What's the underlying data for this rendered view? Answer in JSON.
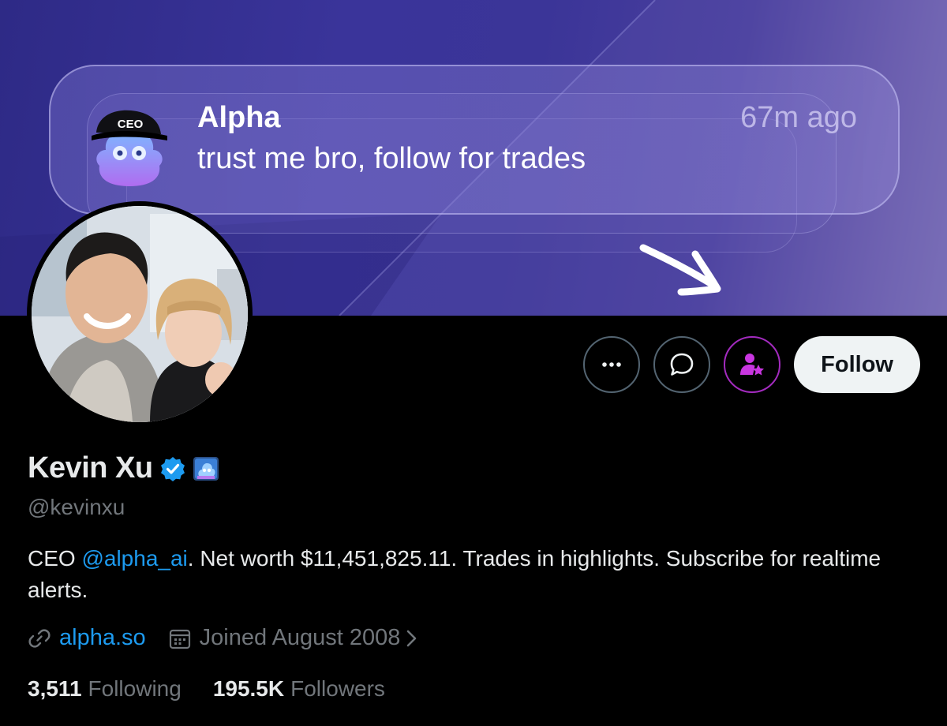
{
  "banner": {
    "notification": {
      "title": "Alpha",
      "message": "trust me bro, follow for trades",
      "time": "67m ago",
      "mascot_cap_text": "CEO"
    }
  },
  "actions": {
    "more_icon": "more-horizontal-icon",
    "message_icon": "chat-bubble-icon",
    "subscribe_icon": "person-star-icon",
    "follow_label": "Follow"
  },
  "profile": {
    "name": "Kevin Xu",
    "handle": "@kevinxu",
    "bio_prefix": "CEO ",
    "bio_mention": "@alpha_ai",
    "bio_suffix": ". Net worth $11,451,825.11. Trades in highlights. Subscribe for realtime alerts.",
    "link": "alpha.so",
    "joined": "Joined August 2008",
    "following_count": "3,511",
    "following_label": "Following",
    "followers_count": "195.5K",
    "followers_label": "Followers"
  },
  "colors": {
    "accent": "#1d9bf0",
    "subscribe": "#a32bbf",
    "muted": "#71767b",
    "text": "#e7e9ea"
  }
}
